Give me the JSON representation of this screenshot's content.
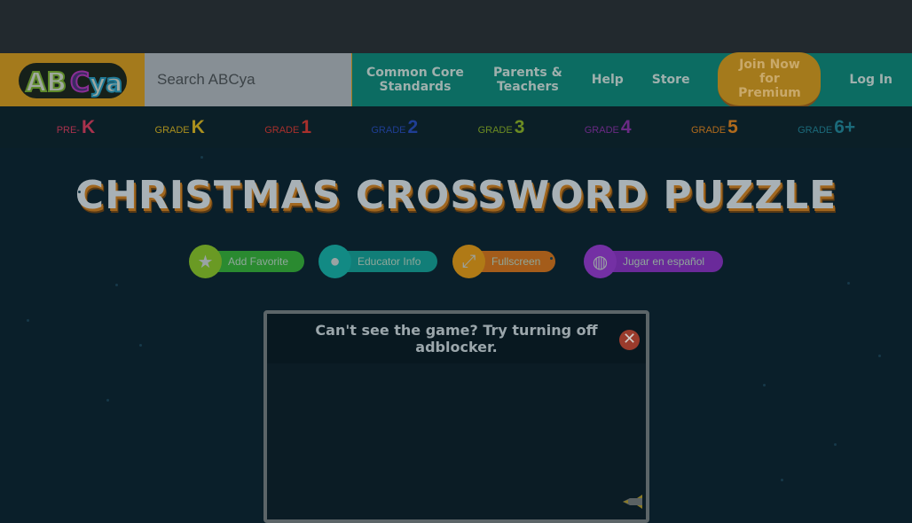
{
  "header": {
    "logo_text": "ABCya",
    "search_placeholder": "Search ABCya",
    "nav": [
      {
        "label": "Common Core Standards"
      },
      {
        "label": "Parents & Teachers"
      },
      {
        "label": "Help"
      },
      {
        "label": "Store"
      },
      {
        "label": "Join Now for Premium"
      },
      {
        "label": "Log In"
      }
    ]
  },
  "grades": [
    {
      "small": "PRE-",
      "big": "K",
      "color": "#a8324d"
    },
    {
      "small": "GRADE",
      "big": "K",
      "color": "#a98f1e"
    },
    {
      "small": "GRADE",
      "big": "1",
      "color": "#a8302c"
    },
    {
      "small": "GRADE",
      "big": "2",
      "color": "#1f3e94"
    },
    {
      "small": "GRADE",
      "big": "3",
      "color": "#6c8c22"
    },
    {
      "small": "GRADE",
      "big": "4",
      "color": "#6a2a84"
    },
    {
      "small": "GRADE",
      "big": "5",
      "color": "#b06a1c"
    },
    {
      "small": "GRADE",
      "big": "6+",
      "color": "#1b6a7a"
    }
  ],
  "title": "CHRISTMAS CROSSWORD PUZZLE",
  "actions": [
    {
      "label": "Add Favorite",
      "icon": "star-icon",
      "color": "#2a8a30",
      "iconColor": "#6a9a24"
    },
    {
      "label": "Educator Info",
      "icon": "apple-icon",
      "color": "#117e78",
      "iconColor": "#128a84"
    },
    {
      "label": "Fullscreen",
      "icon": "expand-icon",
      "color": "#a45c1a",
      "iconColor": "#b07a16"
    },
    {
      "label": "Jugar en español",
      "icon": "globe-icon",
      "color": "#6a2a9a",
      "iconColor": "#7430a4"
    }
  ],
  "game": {
    "notice": "Can't see the game? Try turning off adblocker."
  }
}
